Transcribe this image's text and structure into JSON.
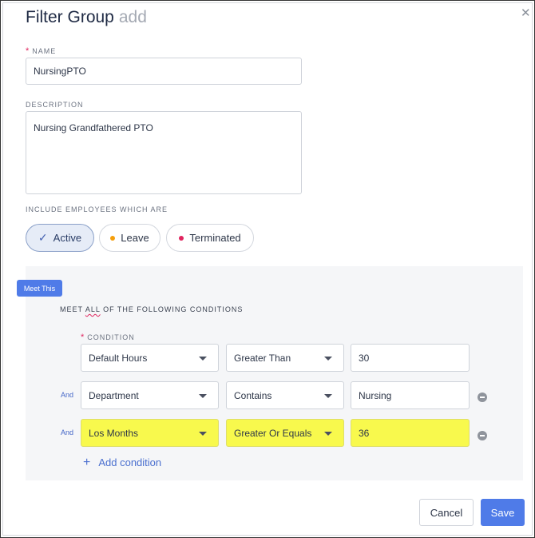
{
  "dialog": {
    "title": "Filter Group",
    "mode": "add",
    "close_glyph": "✕"
  },
  "name": {
    "label": "NAME",
    "required_mark": "*",
    "value": "NursingPTO"
  },
  "description": {
    "label": "DESCRIPTION",
    "value": "Nursing Grandfathered PTO"
  },
  "include": {
    "label": "INCLUDE EMPLOYEES WHICH ARE",
    "options": [
      {
        "label": "Active",
        "selected": true,
        "icon": "check-icon"
      },
      {
        "label": "Leave",
        "selected": false,
        "dot_color": "#f59e0b"
      },
      {
        "label": "Terminated",
        "selected": false,
        "dot_color": "#e0245e"
      }
    ]
  },
  "conditions": {
    "badge": "Meet This",
    "meet_prefix": "MEET",
    "meet_mode": "ALL",
    "meet_suffix": "OF THE FOLLOWING CONDITIONS",
    "condition_label": "CONDITION",
    "required_mark": "*",
    "rows": [
      {
        "connector": "",
        "field": "Default Hours",
        "operator": "Greater Than",
        "value": "30",
        "highlighted": false,
        "removable": false
      },
      {
        "connector": "And",
        "field": "Department",
        "operator": "Contains",
        "value": "Nursing",
        "highlighted": false,
        "removable": true
      },
      {
        "connector": "And",
        "field": "Los Months",
        "operator": "Greater Or Equals",
        "value": "36",
        "highlighted": true,
        "removable": true
      }
    ],
    "add_label": "Add condition",
    "add_glyph": "+"
  },
  "footer": {
    "cancel_label": "Cancel",
    "save_label": "Save"
  },
  "colors": {
    "accent": "#4f7be8",
    "highlight": "#f8f94d",
    "link": "#4a6fcf"
  }
}
